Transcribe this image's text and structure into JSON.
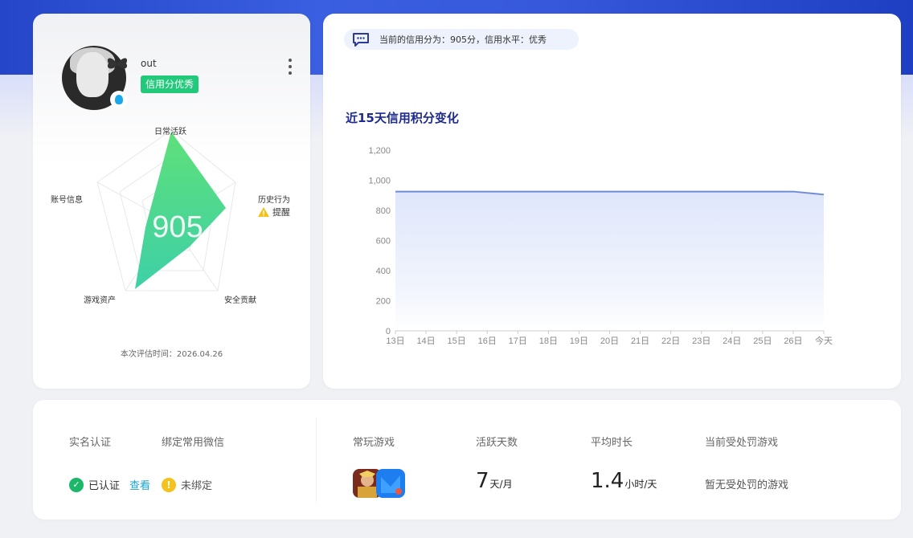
{
  "profile": {
    "username": "out",
    "credit_tag": "信用分优秀",
    "score": "905",
    "radar_labels": {
      "daily": "日常活跃",
      "history": "历史行为",
      "history_warn": "提醒",
      "security": "安全贡献",
      "assets": "游戏资产",
      "account": "账号信息"
    },
    "eval_time": "本次评估时间：2026.04.26"
  },
  "status": {
    "text": "当前的信用分为：905分，信用水平：优秀"
  },
  "chart_title": "近15天信用积分变化",
  "chart_data": {
    "type": "area",
    "title": "近15天信用积分变化",
    "categories": [
      "13日",
      "14日",
      "15日",
      "16日",
      "17日",
      "18日",
      "19日",
      "20日",
      "21日",
      "22日",
      "23日",
      "24日",
      "25日",
      "26日",
      "今天"
    ],
    "series": [
      {
        "values": [
          925,
          925,
          925,
          925,
          925,
          925,
          925,
          925,
          925,
          925,
          925,
          925,
          925,
          925,
          905
        ]
      }
    ],
    "yticks": [
      "0",
      "200",
      "400",
      "600",
      "800",
      "1,000",
      "1,200"
    ],
    "ylim": [
      0,
      1200
    ],
    "grid": true,
    "color": "#6f8bd8"
  },
  "stats": {
    "real_name_label": "实名认证",
    "real_name_value": "已认证",
    "view_link": "查看",
    "wechat_label": "绑定常用微信",
    "wechat_value": "未绑定",
    "games_label": "常玩游戏",
    "active_days_label": "活跃天数",
    "active_days_value": "7",
    "active_days_unit": "天/月",
    "avg_time_label": "平均时长",
    "avg_time_value": "1.4",
    "avg_time_unit": "小时/天",
    "punish_label": "当前受处罚游戏",
    "punish_value": "暂无受处罚的游戏"
  },
  "colors": {
    "accent_green": "#22c97a",
    "title_blue": "#1e2b8c",
    "link_blue": "#1aa5d8",
    "warn_yellow": "#f4c21a"
  }
}
